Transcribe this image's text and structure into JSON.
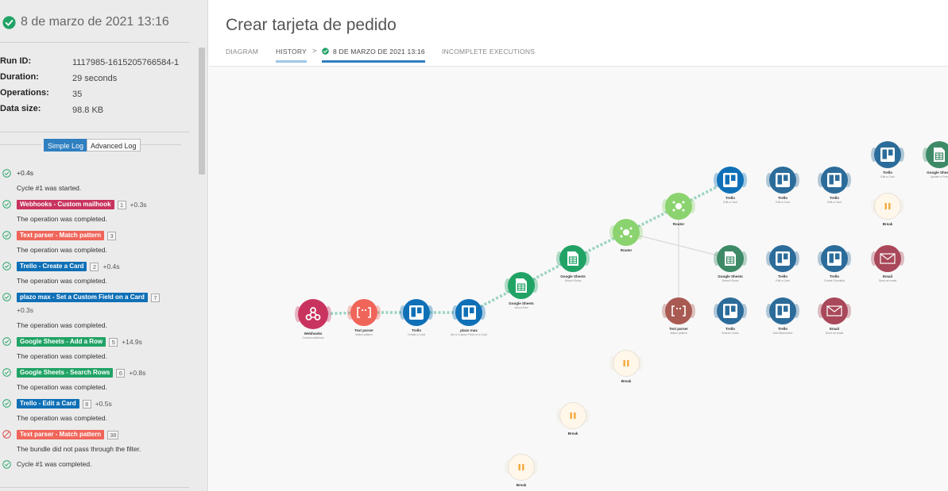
{
  "left": {
    "title": "8 de marzo de 2021 13:16",
    "meta": [
      {
        "key": "Run ID:",
        "value": "1117985-1615205766584-1"
      },
      {
        "key": "Duration:",
        "value": "29 seconds"
      },
      {
        "key": "Operations:",
        "value": "35"
      },
      {
        "key": "Data size:",
        "value": "98.8 KB"
      }
    ],
    "tabs": {
      "simple": "Simple Log",
      "advanced": "Advanced Log"
    },
    "log": [
      {
        "icon": "check-circle-icon",
        "line1": "+0.4s",
        "line2": "Cycle #1 was started."
      },
      {
        "icon": "check-circle-icon",
        "badge": "Webhooks - Custom mailhook",
        "color": "#c8345e",
        "num": "1",
        "delta": "+0.3s",
        "line2": "The operation was completed."
      },
      {
        "icon": "check-circle-icon",
        "badge": "Text parser - Match pattern",
        "color": "#f0655a",
        "num": "3",
        "line2": "The operation was completed."
      },
      {
        "icon": "check-circle-icon",
        "badge": "Trello - Create a Card",
        "color": "#0f70b7",
        "num": "2",
        "delta": "+0.4s",
        "line2": "The operation was completed."
      },
      {
        "icon": "check-circle-icon",
        "badge": "plazo max - Set a Custom Field on a Card",
        "color": "#0f70b7",
        "num": "7",
        "delta": "+0.3s",
        "line2": "The operation was completed."
      },
      {
        "icon": "check-circle-icon",
        "badge": "Google Sheets - Add a Row",
        "color": "#21a366",
        "num": "5",
        "delta": "+14.9s",
        "line2": "The operation was completed."
      },
      {
        "icon": "check-circle-icon",
        "badge": "Google Sheets - Search Rows",
        "color": "#21a366",
        "num": "6",
        "delta": "+0.8s",
        "line2": "The operation was completed."
      },
      {
        "icon": "check-circle-icon",
        "badge": "Trello - Edit a Card",
        "color": "#0f70b7",
        "num": "8",
        "delta": "+0.5s",
        "line2": "The operation was completed."
      },
      {
        "icon": "stop-circle-icon",
        "badge": "Text parser - Match pattern",
        "color": "#f0655a",
        "num": "38",
        "line2": "The bundle did not pass through the filter."
      },
      {
        "icon": "check-circle-icon",
        "line1": "Cycle #1 was completed."
      }
    ]
  },
  "header": {
    "title": "Crear tarjeta de pedido",
    "tabs": {
      "diagram": "DIAGRAM",
      "history": "HISTORY",
      "arrow": ">",
      "execution": "8 DE MARZO DE 2021 13:16",
      "incomplete": "INCOMPLETE EXECUTIONS"
    }
  },
  "colors": {
    "webhooks": "#c8345e",
    "textparser": "#f0655a",
    "textparser_muted": "#a95a52",
    "trello": "#0f70b7",
    "trello_muted": "#2c6c9a",
    "sheets": "#21a366",
    "sheets_muted": "#3e8a67",
    "router": "#8bd36f",
    "email": "#a9485a",
    "break": "#fff7ea",
    "success": "#21a366"
  },
  "nodes": [
    {
      "id": "webhooks",
      "label": "Webhooks",
      "sub": "Custom mailhook",
      "icon": "webhook-icon"
    },
    {
      "id": "textparser1",
      "label": "Text parser",
      "sub": "Match pattern",
      "icon": "text-parser-icon"
    },
    {
      "id": "trello1",
      "label": "Trello",
      "sub": "Create a Card",
      "icon": "trello-icon"
    },
    {
      "id": "plazo",
      "label": "plazo max",
      "sub": "Set a Custom Field on a Card",
      "icon": "trello-icon"
    },
    {
      "id": "sheets1",
      "label": "Google Sheets",
      "sub": "Add a Row",
      "icon": "sheets-icon"
    },
    {
      "id": "sheets2",
      "label": "Google Sheets",
      "sub": "Search Rows",
      "icon": "sheets-icon"
    },
    {
      "id": "router1",
      "label": "Router",
      "sub": "",
      "icon": "router-icon"
    },
    {
      "id": "router2",
      "label": "Router",
      "sub": "",
      "icon": "router-icon"
    },
    {
      "id": "trello2",
      "label": "Trello",
      "sub": "Edit a Card",
      "icon": "trello-icon"
    },
    {
      "id": "trello3",
      "label": "Trello",
      "sub": "Edit a Card",
      "icon": "trello-icon"
    },
    {
      "id": "trello4",
      "label": "Trello",
      "sub": "Edit a Card",
      "icon": "trello-icon"
    },
    {
      "id": "trello5",
      "label": "Trello",
      "sub": "Edit a Card",
      "icon": "trello-icon"
    },
    {
      "id": "sheets3",
      "label": "Google Sheets",
      "sub": "Update a Row",
      "icon": "sheets-icon"
    },
    {
      "id": "break1",
      "label": "Break",
      "sub": "",
      "icon": "pause-icon"
    },
    {
      "id": "sheets4",
      "label": "Google Sheets",
      "sub": "Search Rows",
      "icon": "sheets-icon"
    },
    {
      "id": "trello6",
      "label": "Trello",
      "sub": "Edit a Card",
      "icon": "trello-icon"
    },
    {
      "id": "trello7",
      "label": "Trello",
      "sub": "Create Checklist",
      "icon": "trello-icon"
    },
    {
      "id": "email1",
      "label": "Email",
      "sub": "Send an email",
      "icon": "email-icon"
    },
    {
      "id": "textparser2",
      "label": "Text parser",
      "sub": "Match pattern",
      "icon": "text-parser-icon"
    },
    {
      "id": "trello8",
      "label": "Trello",
      "sub": "Search Cards",
      "icon": "trello-icon"
    },
    {
      "id": "trello9",
      "label": "Trello",
      "sub": "Add Attachment",
      "icon": "trello-icon"
    },
    {
      "id": "email2",
      "label": "Email",
      "sub": "Send an email",
      "icon": "email-icon"
    },
    {
      "id": "break2",
      "label": "Break",
      "sub": "",
      "icon": "pause-icon"
    },
    {
      "id": "break3",
      "label": "Break",
      "sub": "",
      "icon": "pause-icon"
    },
    {
      "id": "break4",
      "label": "Break",
      "sub": "",
      "icon": "pause-icon"
    }
  ]
}
